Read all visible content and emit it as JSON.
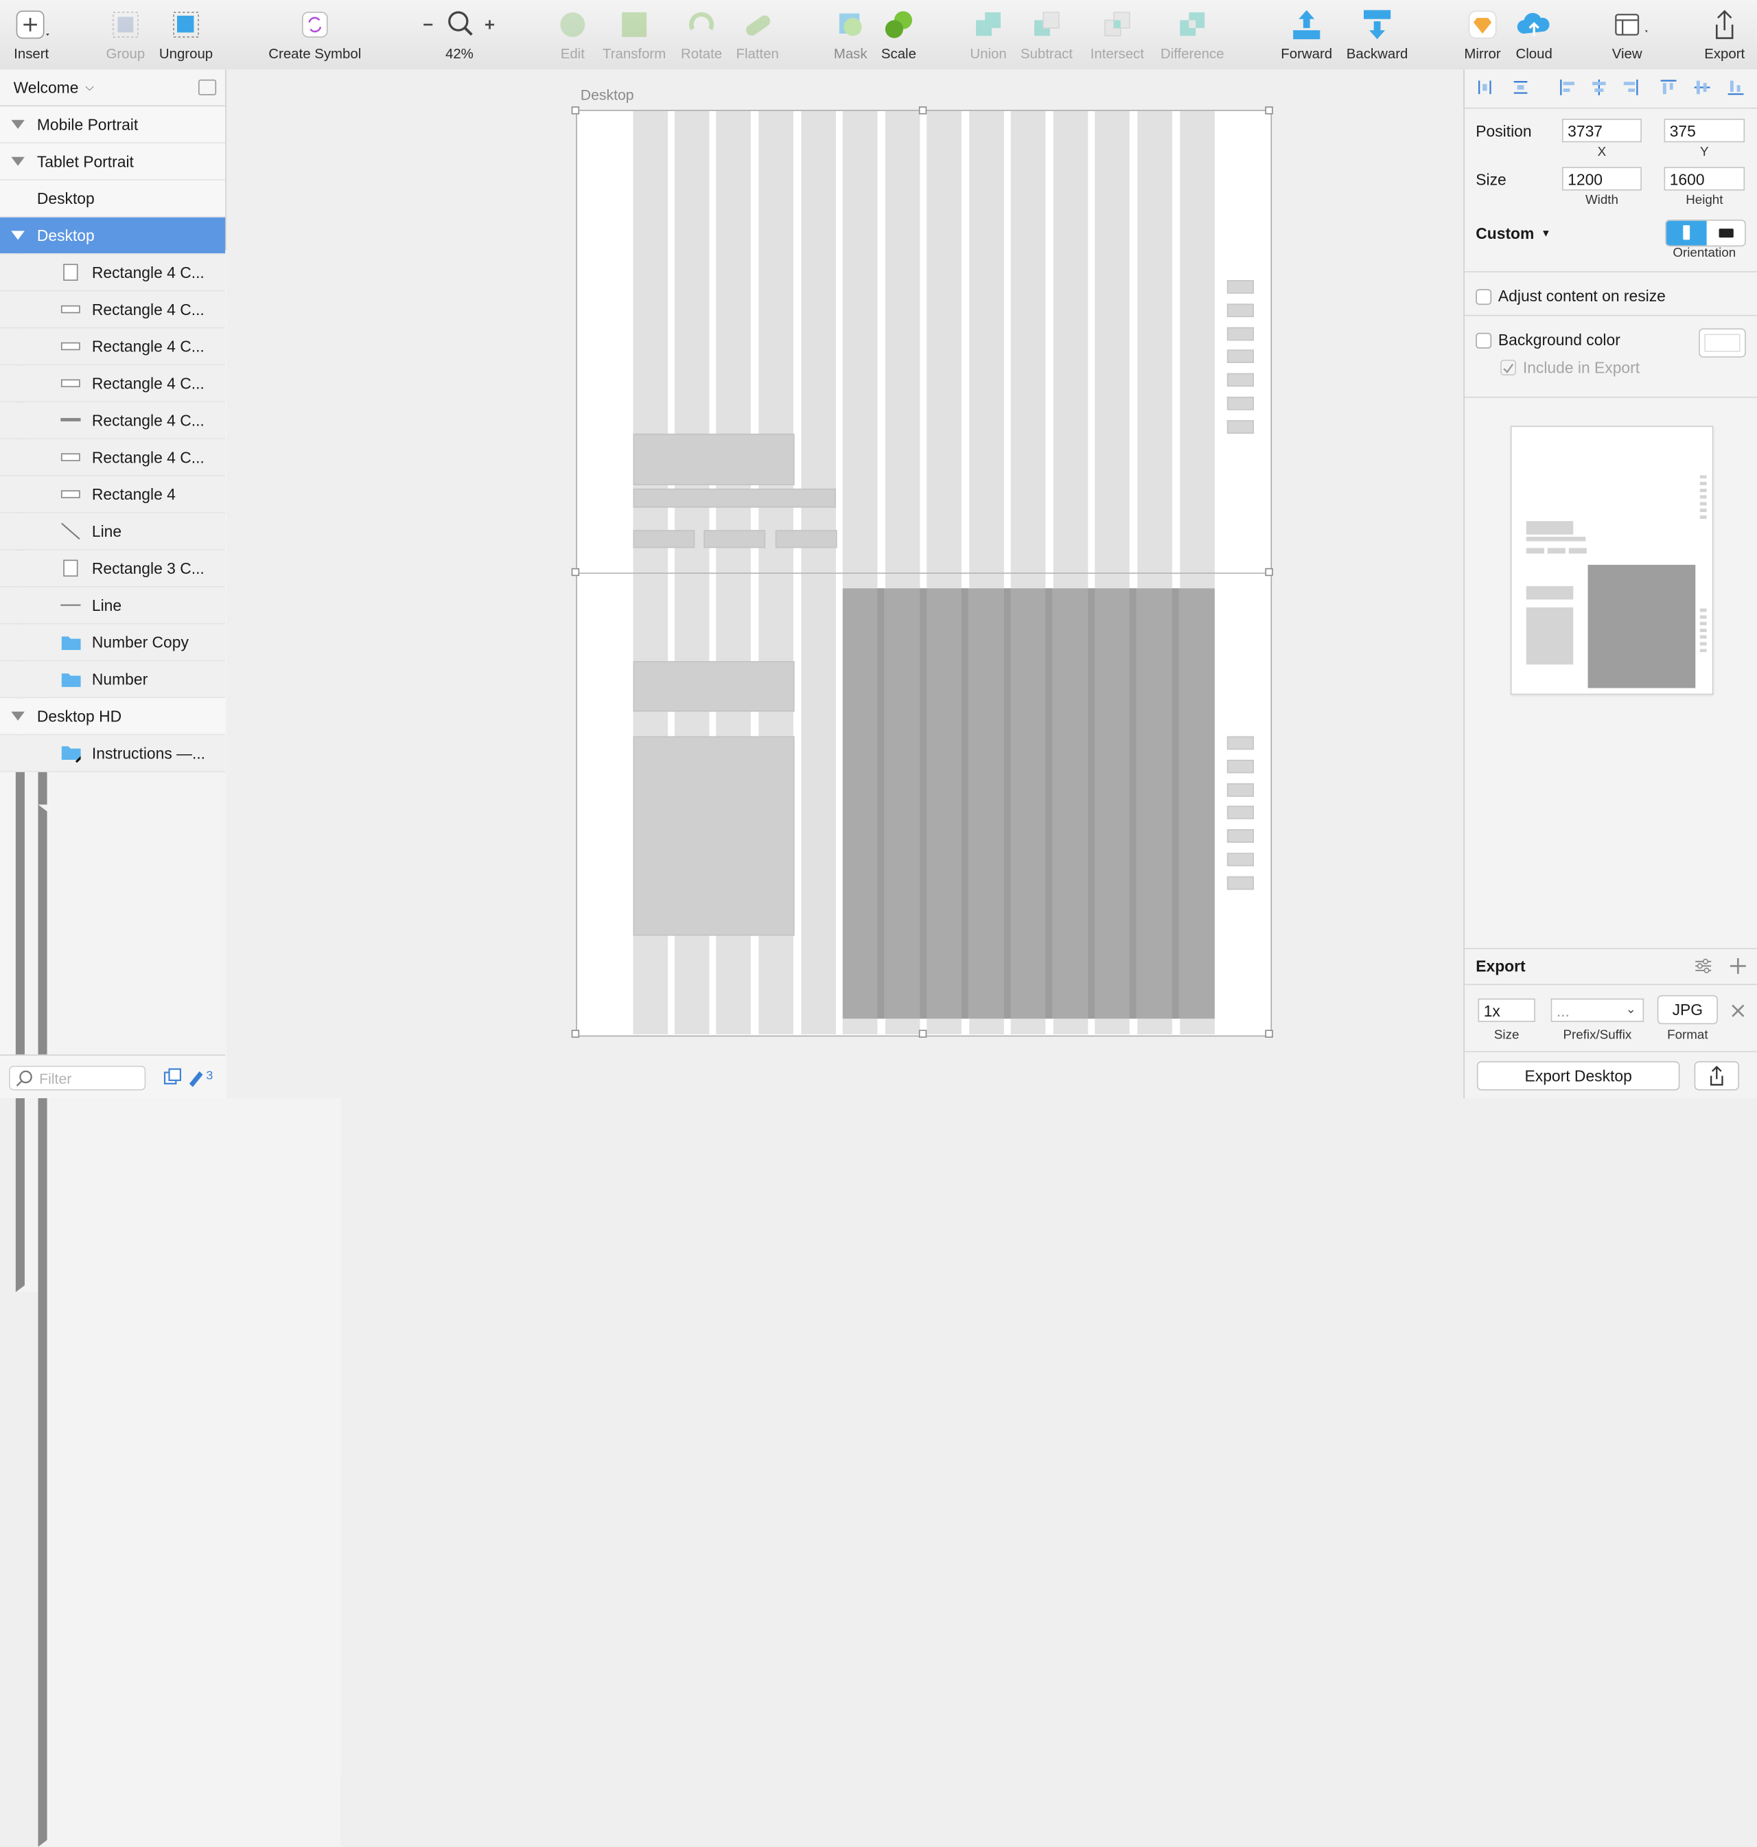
{
  "toolbar": {
    "insert": "Insert",
    "group": "Group",
    "ungroup": "Ungroup",
    "create_symbol": "Create Symbol",
    "zoom": "42%",
    "edit": "Edit",
    "transform": "Transform",
    "rotate": "Rotate",
    "flatten": "Flatten",
    "mask": "Mask",
    "scale": "Scale",
    "union": "Union",
    "subtract": "Subtract",
    "intersect": "Intersect",
    "difference": "Difference",
    "forward": "Forward",
    "backward": "Backward",
    "mirror": "Mirror",
    "cloud": "Cloud",
    "view": "View",
    "export": "Export"
  },
  "layers": {
    "page": "Welcome",
    "items": [
      {
        "label": "Mobile Portrait",
        "icon": "triangle-down"
      },
      {
        "label": "Tablet Portrait",
        "icon": "triangle-down"
      },
      {
        "label": "Desktop",
        "icon": "triangle-right"
      },
      {
        "label": "Desktop",
        "icon": "triangle-down"
      },
      {
        "label": "Rectangle 4 C...",
        "icon": "rectangle-tall-icon"
      },
      {
        "label": "Rectangle 4 C...",
        "icon": "rectangle-wide-icon"
      },
      {
        "label": "Rectangle 4 C...",
        "icon": "rectangle-wide-icon"
      },
      {
        "label": "Rectangle 4 C...",
        "icon": "rectangle-wide-icon"
      },
      {
        "label": "Rectangle 4 C...",
        "icon": "rectangle-bar-icon"
      },
      {
        "label": "Rectangle 4 C...",
        "icon": "rectangle-wide-icon"
      },
      {
        "label": "Rectangle 4",
        "icon": "rectangle-wide-icon"
      },
      {
        "label": "Line",
        "icon": "line-diagonal-icon"
      },
      {
        "label": "Rectangle 3 C...",
        "icon": "rectangle-tall-icon"
      },
      {
        "label": "Line",
        "icon": "line-horizontal-icon"
      },
      {
        "label": "Number Copy",
        "icon": "folder-icon"
      },
      {
        "label": "Number",
        "icon": "folder-icon"
      },
      {
        "label": "Desktop HD",
        "icon": "triangle-down"
      },
      {
        "label": "Instructions —...",
        "icon": "folder-pen-icon"
      }
    ],
    "filter_placeholder": "Filter",
    "footer_count": "3"
  },
  "canvas": {
    "artboard_name": "Desktop"
  },
  "inspector": {
    "position_label": "Position",
    "x": "3737",
    "y": "375",
    "x_label": "X",
    "y_label": "Y",
    "size_label": "Size",
    "width": "1200",
    "height": "1600",
    "width_label": "Width",
    "height_label": "Height",
    "preset": "Custom",
    "orientation_label": "Orientation",
    "adjust_content": "Adjust content on resize",
    "background_color": "Background color",
    "include_in_export": "Include in Export",
    "export_title": "Export",
    "export_size": "1x",
    "export_prefix": "...",
    "export_format": "JPG",
    "size_caption": "Size",
    "prefix_caption": "Prefix/Suffix",
    "format_caption": "Format",
    "export_button": "Export Desktop"
  },
  "colors": {
    "selection": "#5c97e3",
    "accent_blue": "#3aa6e8",
    "teal": "#4fc7b8",
    "green": "#7cc43a"
  }
}
